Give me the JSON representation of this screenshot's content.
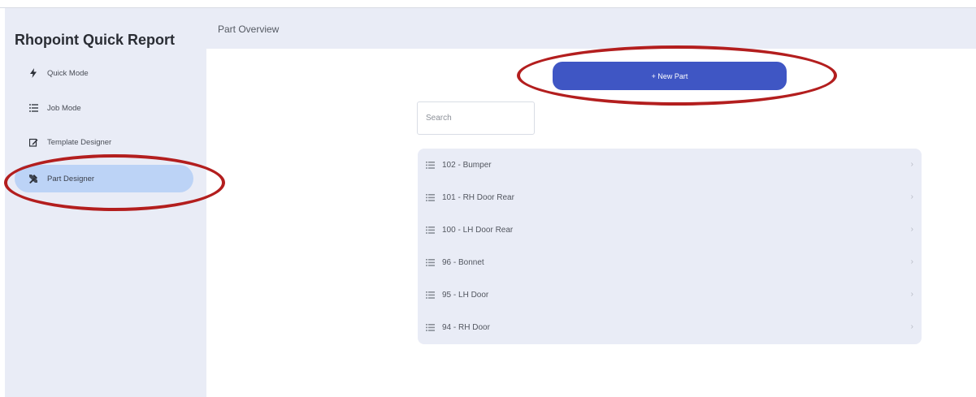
{
  "app": {
    "title": "Rhopoint Quick Report"
  },
  "sidebar": {
    "items": [
      {
        "label": "Quick Mode",
        "icon": "lightning-icon",
        "active": false
      },
      {
        "label": "Job Mode",
        "icon": "list-icon",
        "active": false
      },
      {
        "label": "Template Designer",
        "icon": "edit-icon",
        "active": false
      },
      {
        "label": "Part Designer",
        "icon": "tools-icon",
        "active": true
      }
    ]
  },
  "header": {
    "title": "Part Overview"
  },
  "main": {
    "new_part_label": "+ New Part",
    "search": {
      "placeholder": "Search",
      "value": ""
    },
    "parts": [
      {
        "label": "102 - Bumper"
      },
      {
        "label": "101 - RH Door Rear"
      },
      {
        "label": "100 - LH Door Rear"
      },
      {
        "label": "96 - Bonnet"
      },
      {
        "label": "95 - LH Door"
      },
      {
        "label": "94 - RH Door"
      }
    ]
  },
  "colors": {
    "sidebar_bg": "#e9ecf6",
    "active_item_bg": "#bcd3f6",
    "primary_button": "#3f56c4",
    "annotation_circle": "#b31e1e"
  }
}
